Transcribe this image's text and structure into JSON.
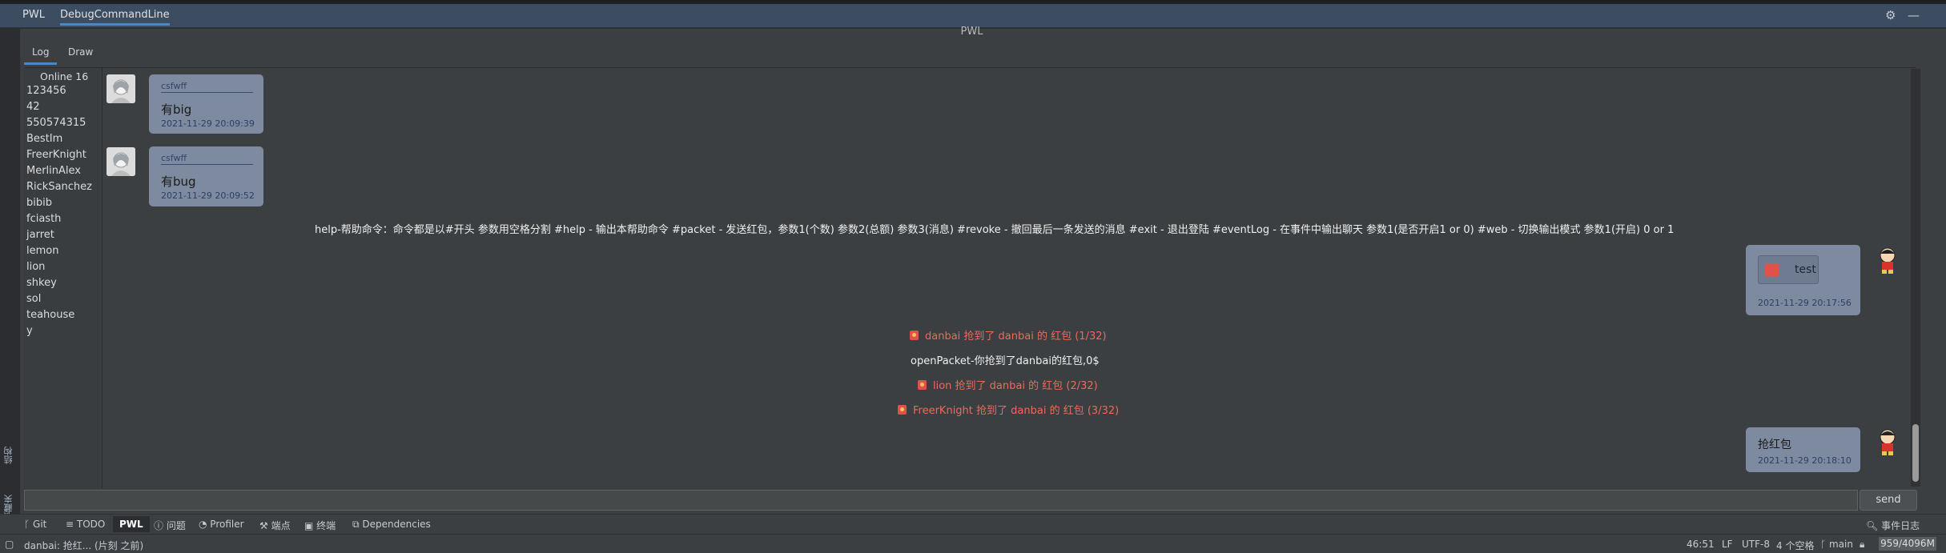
{
  "titlebar": {
    "app_tab": "PWL",
    "active_tab": "DebugCommandLine",
    "settings_icon": "gear-icon",
    "minimize_icon": "minus-icon"
  },
  "panel_title": "PWL",
  "inner_tabs": {
    "log": "Log",
    "draw": "Draw"
  },
  "side_labels": {
    "structure": "结构",
    "favorites": "收藏夹"
  },
  "users": {
    "online_label": "Online 16",
    "names": [
      "123456",
      "42",
      "550574315",
      "BestIm",
      "FreerKnight",
      "MerlinAlex",
      "RickSanchez",
      "bibib",
      "fciasth",
      "jarret",
      "lemon",
      "lion",
      "shkey",
      "sol",
      "teahouse",
      "y"
    ]
  },
  "messages": {
    "m1": {
      "sender": "csfwff",
      "text": "有big",
      "time": "2021-11-29 20:09:39"
    },
    "m2": {
      "sender": "csfwff",
      "text": "有bug",
      "time": "2021-11-29 20:09:52"
    },
    "help": "help-帮助命令：命令都是以#开头 参数用空格分割 #help - 输出本帮助命令 #packet - 发送红包，参数1(个数) 参数2(总额) 参数3(消息) #revoke - 撤回最后一条发送的消息 #exit - 退出登陆 #eventLog - 在事件中输出聊天 参数1(是否开启1 or 0) #web - 切换输出模式 参数1(开启) 0 or 1",
    "m3": {
      "text": "test",
      "time": "2021-11-29 20:17:56"
    },
    "grab1": "danbai 抢到了 danbai 的 红包 (1/32)",
    "open_packet": "openPacket-你抢到了danbai的红包,0$",
    "grab2": "lion 抢到了 danbai 的 红包 (2/32)",
    "grab3": "FreerKnight 抢到了 danbai 的 红包 (3/32)",
    "m4": {
      "text": "抢红包",
      "time": "2021-11-29 20:18:10"
    }
  },
  "input": {
    "value": "",
    "send_label": "send"
  },
  "toolbar": {
    "git": "Git",
    "todo": "TODO",
    "pwl": "PWL",
    "problems": "问题",
    "profiler": "Profiler",
    "build": "端点",
    "terminal": "终端",
    "dependencies": "Dependencies",
    "event_log": "事件日志"
  },
  "status": {
    "message": "danbai: 抢红... (片刻 之前)",
    "position": "46:51",
    "line_sep": "LF",
    "encoding": "UTF-8",
    "indent": "4 个空格",
    "branch": "main",
    "memory": "959/4096M"
  },
  "colors": {
    "accent": "#4a88c7",
    "bubble": "#7d8a9f",
    "red_text": "#ec6a5c"
  }
}
